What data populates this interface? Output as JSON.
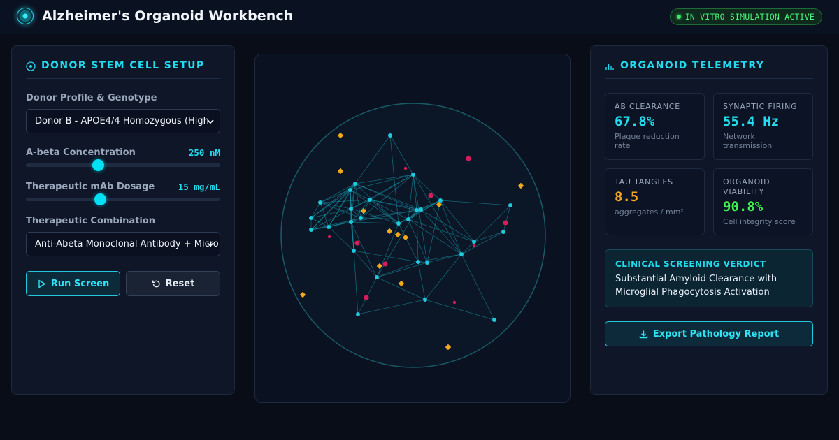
{
  "app": {
    "title": "Alzheimer's Organoid Workbench",
    "logo_icon": "organoid-logo-icon",
    "status": "IN VITRO SIMULATION ACTIVE"
  },
  "setup": {
    "heading": "DONOR STEM CELL SETUP",
    "heading_icon": "target-icon",
    "donor_label": "Donor Profile & Genotype",
    "donor_value": "Donor B - APOE4/4 Homozygous (High",
    "abeta_label": "A-beta Concentration",
    "abeta_value": "250 nM",
    "abeta_level": 0.37,
    "mab_label": "Therapeutic mAb Dosage",
    "mab_value": "15 mg/mL",
    "mab_level": 0.38,
    "combo_label": "Therapeutic Combination",
    "combo_value": "Anti-Abeta Monoclonal Antibody + Micro",
    "run_label": "Run Screen",
    "reset_label": "Reset"
  },
  "telemetry": {
    "heading": "ORGANOID TELEMETRY",
    "heading_icon": "bar-chart-icon",
    "metrics": [
      {
        "label": "AB CLEARANCE",
        "value": "67.8%",
        "sub": "Plaque reduction rate",
        "color": "#22dced"
      },
      {
        "label": "SYNAPTIC FIRING",
        "value": "55.4 Hz",
        "sub": "Network transmission",
        "color": "#22dced"
      },
      {
        "label": "TAU TANGLES",
        "value": "8.5",
        "sub": "aggregates / mm²",
        "color": "#f5a524"
      },
      {
        "label": "ORGANOID VIABILITY",
        "value": "90.8%",
        "sub": "Cell integrity score",
        "color": "#3ef04a"
      }
    ],
    "verdict_title": "CLINICAL SCREENING VERDICT",
    "verdict_text": "Substantial Amyloid Clearance with Microglial Phagocytosis Activation",
    "export_label": "Export Pathology Report"
  },
  "colors": {
    "accent": "#22dced",
    "neuron": "#1fc8dc",
    "plaque": "#f0a81c",
    "tau": "#d81b5a",
    "status": "#3ee86b"
  }
}
